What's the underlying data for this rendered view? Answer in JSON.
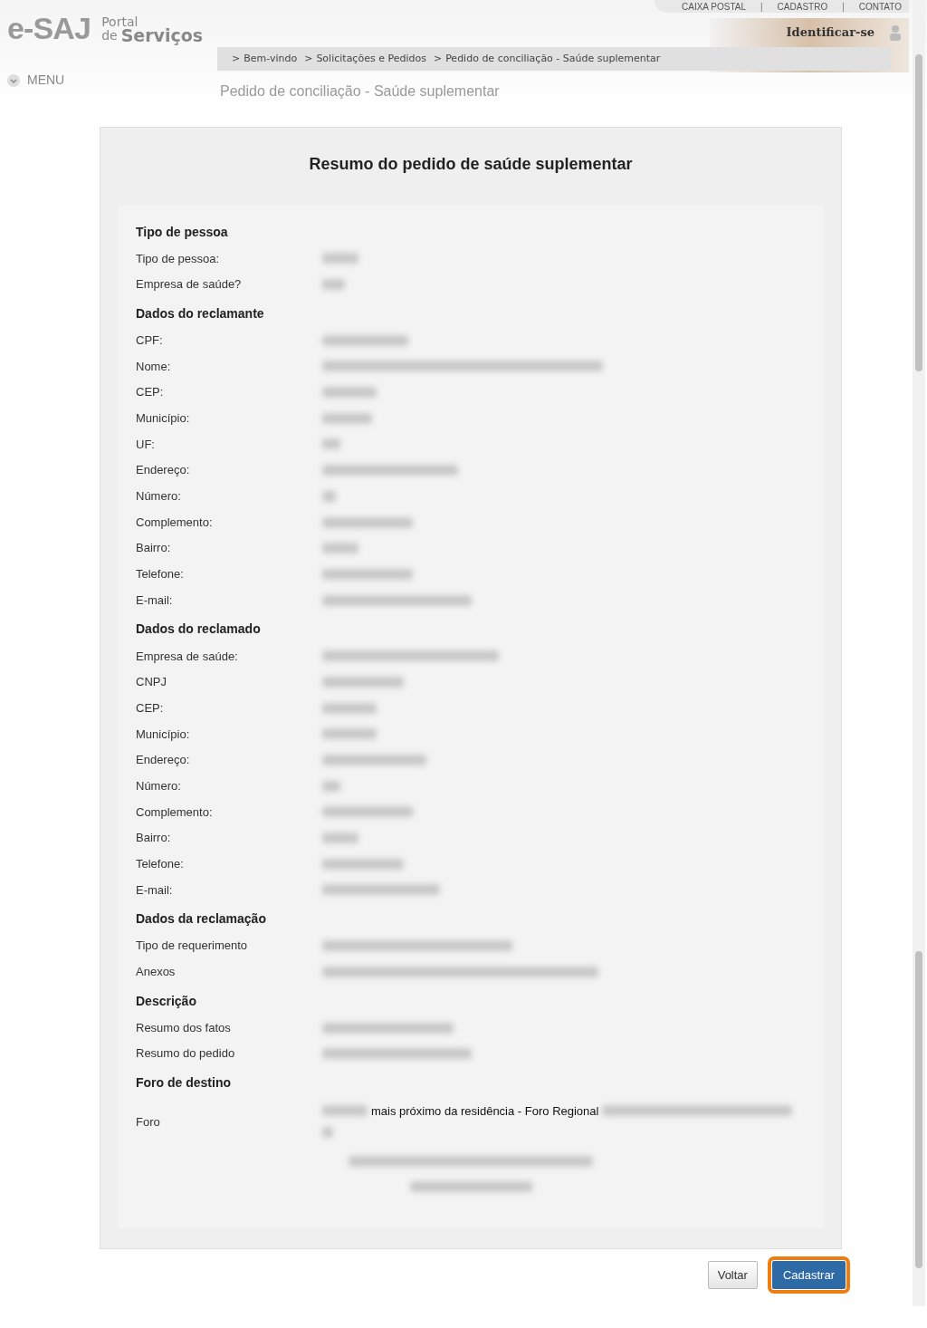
{
  "header": {
    "logo": "e-SAJ",
    "portal": "Portal",
    "de": "de",
    "servicos": "Serviços",
    "top_links": [
      "CAIXA POSTAL",
      "CADASTRO",
      "CONTATO"
    ],
    "link_separator": "|",
    "breadcrumb_separator": ">",
    "login": "Identificar-se",
    "menu": "MENU",
    "breadcrumb": [
      "Bem-vindo",
      "Solicitações e Pedidos",
      "Pedido de conciliação - Saúde suplementar"
    ],
    "page_title": "Pedido de conciliação - Saúde suplementar"
  },
  "card": {
    "title": "Resumo do pedido de saúde suplementar",
    "sections": [
      {
        "title": "Tipo de pessoa",
        "fields": [
          "Tipo de pessoa:",
          "Empresa de saúde?"
        ]
      },
      {
        "title": "Dados do reclamante",
        "fields": [
          "CPF:",
          "Nome:",
          "CEP:",
          "Município:",
          "UF:",
          "Endereço:",
          "Número:",
          "Complemento:",
          "Bairro:",
          "Telefone:",
          "E-mail:"
        ]
      },
      {
        "title": "Dados do reclamado",
        "fields": [
          "Empresa de saúde:",
          "CNPJ",
          "CEP:",
          "Município:",
          "Endereço:",
          "Número:",
          "Complemento:",
          "Bairro:",
          "Telefone:",
          "E-mail:"
        ]
      },
      {
        "title": "Dados da reclamação",
        "fields": [
          "Tipo de requerimento",
          "Anexos"
        ]
      },
      {
        "title": "Descrição",
        "fields": [
          "Resumo dos fatos",
          "Resumo do pedido"
        ]
      },
      {
        "title": "Foro de destino"
      }
    ],
    "foro": {
      "label": "Foro",
      "value": "mais próximo da residência - Foro Regional"
    }
  },
  "buttons": [
    {
      "label": "Voltar",
      "kind": "secondary"
    },
    {
      "label": "Cadastrar",
      "kind": "primary"
    }
  ]
}
